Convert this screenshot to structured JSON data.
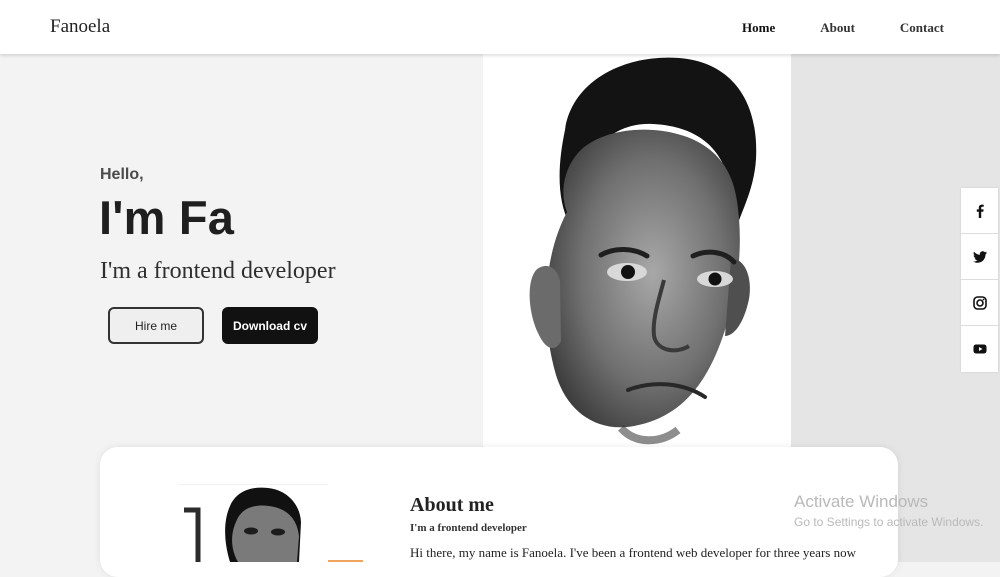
{
  "header": {
    "brand": "Fanoela",
    "nav": [
      {
        "label": "Home"
      },
      {
        "label": "About"
      },
      {
        "label": "Contact"
      }
    ]
  },
  "hero": {
    "greeting": "Hello,",
    "headline": "I'm Fa",
    "subtitle": "I'm a frontend developer",
    "buttons": {
      "hire": "Hire me",
      "download": "Download cv"
    }
  },
  "about": {
    "title": "About me",
    "subtitle": "I'm a frontend developer",
    "body": "Hi there, my name is Fanoela. I've been a frontend web developer for three years now"
  },
  "social": [
    {
      "icon": "facebook-icon"
    },
    {
      "icon": "twitter-icon"
    },
    {
      "icon": "instagram-icon"
    },
    {
      "icon": "youtube-icon"
    }
  ],
  "watermark": {
    "title": "Activate Windows",
    "subtitle": "Go to Settings to activate Windows."
  }
}
